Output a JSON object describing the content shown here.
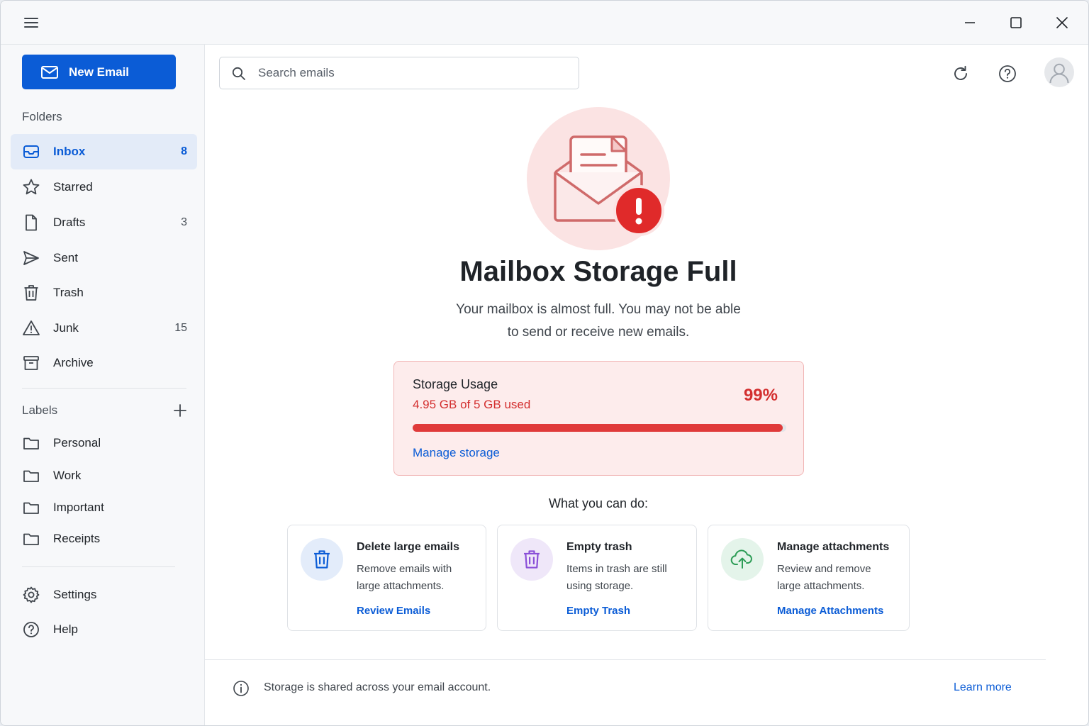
{
  "window": {
    "menu_icon": "hamburger-icon",
    "controls": [
      "minimize-icon",
      "maximize-icon",
      "close-icon"
    ]
  },
  "sidebar": {
    "new_email_label": "New Email",
    "folders_heading": "Folders",
    "folders": [
      {
        "label": "Inbox",
        "count": "8",
        "icon": "inbox-icon",
        "active": true
      },
      {
        "label": "Starred",
        "count": "",
        "icon": "star-icon"
      },
      {
        "label": "Drafts",
        "count": "3",
        "icon": "draft-icon"
      },
      {
        "label": "Sent",
        "count": "",
        "icon": "send-icon"
      },
      {
        "label": "Trash",
        "count": "",
        "icon": "trash-icon"
      },
      {
        "label": "Junk",
        "count": "15",
        "icon": "warning-icon"
      },
      {
        "label": "Archive",
        "count": "",
        "icon": "archive-icon"
      }
    ],
    "labels_heading": "Labels",
    "labels": [
      {
        "label": "Personal",
        "icon": "folder-icon"
      },
      {
        "label": "Work",
        "icon": "folder-icon"
      },
      {
        "label": "Important",
        "icon": "folder-icon"
      },
      {
        "label": "Receipts",
        "icon": "folder-icon"
      }
    ],
    "bottom": [
      {
        "label": "Settings",
        "icon": "gear-icon"
      },
      {
        "label": "Help",
        "icon": "help-icon"
      }
    ]
  },
  "toolbar": {
    "search_placeholder": "Search emails",
    "refresh_icon": "refresh-icon",
    "help_icon": "help-icon",
    "avatar_icon": "user-icon"
  },
  "main": {
    "title": "Mailbox Storage Full",
    "subtitle_line1": "Your mailbox is almost full. You may not be able",
    "subtitle_line2": "to send or receive new emails.",
    "storage": {
      "heading": "Storage Usage",
      "used_text": "4.95 GB of 5 GB used",
      "percent_text": "99%",
      "percent_value": 0.99,
      "manage_link": "Manage storage"
    },
    "actions_heading": "What you can do:",
    "actions": [
      {
        "title": "Delete large emails",
        "desc": "Remove emails with large attachments.",
        "link": "Review Emails",
        "icon": "trash-icon"
      },
      {
        "title": "Empty trash",
        "desc": "Items in trash are still using storage.",
        "link": "Empty Trash",
        "icon": "trash-icon"
      },
      {
        "title": "Manage attachments",
        "desc": "Review and remove large attachments.",
        "link": "Manage Attachments",
        "icon": "cloud-upload-icon"
      }
    ],
    "footer_text": "Storage is shared across your email account.",
    "footer_link": "Learn more"
  },
  "colors": {
    "accent": "#0b5cd6",
    "danger": "#d32f2f",
    "danger_bg": "#fdecec"
  }
}
